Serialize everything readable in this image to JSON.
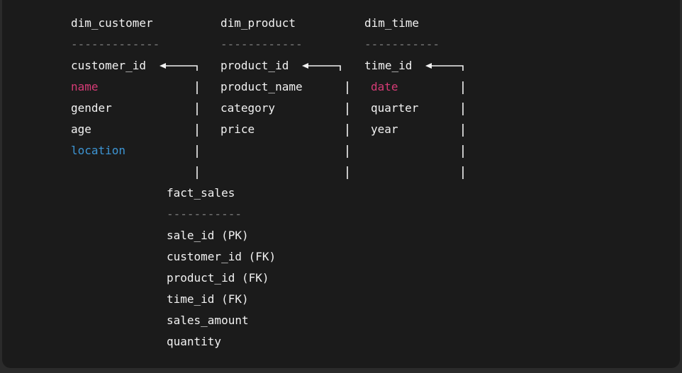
{
  "dim_customer": {
    "title": "dim_customer",
    "separator": "-------------",
    "fields": [
      "customer_id",
      "name",
      "gender",
      "age",
      "location"
    ]
  },
  "dim_product": {
    "title": "dim_product",
    "separator": "------------",
    "fields": [
      "product_id",
      "product_name",
      "category",
      "price"
    ]
  },
  "dim_time": {
    "title": "dim_time",
    "separator": "-----------",
    "fields": [
      "time_id",
      "date",
      "quarter",
      "year"
    ]
  },
  "fact_sales": {
    "title": "fact_sales",
    "separator": "-----------",
    "fields": [
      "sale_id (PK)",
      "customer_id (FK)",
      "product_id (FK)",
      "time_id (FK)",
      "sales_amount",
      "quantity"
    ]
  },
  "colors": {
    "background": "#1b1b1b",
    "text": "#f2f2f2",
    "separator": "#7c7c7c",
    "highlight_pink": "#d63b76",
    "highlight_blue": "#3d95d4"
  }
}
